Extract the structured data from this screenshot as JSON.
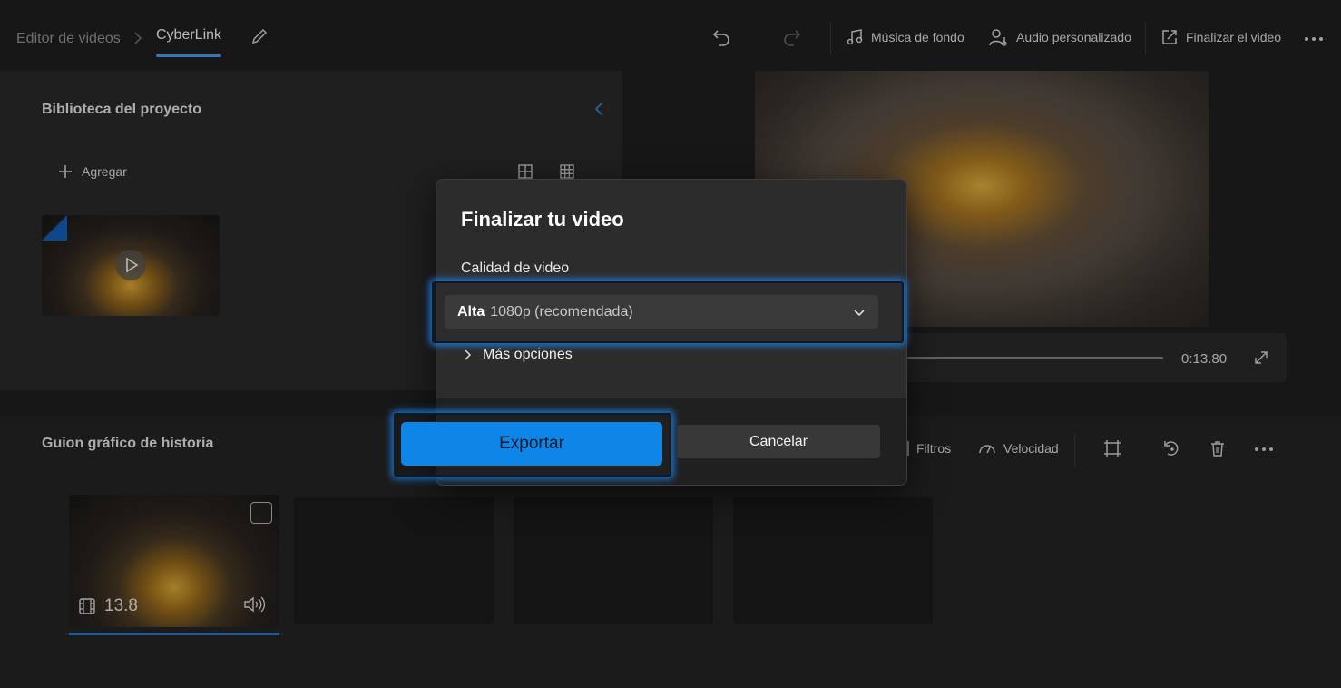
{
  "breadcrumb": {
    "root": "Editor de videos",
    "current": "CyberLink"
  },
  "toolbar": {
    "music_label": "Música de fondo",
    "audio_label": "Audio personalizado",
    "finish_label": "Finalizar el video"
  },
  "library": {
    "title": "Biblioteca del proyecto",
    "add_label": "Agregar"
  },
  "player": {
    "time": "0:13.80"
  },
  "storyboard": {
    "title": "Guion gráfico de historia",
    "filters_label": "Filtros",
    "speed_label": "Velocidad",
    "clip_duration": "13.8"
  },
  "dialog": {
    "title": "Finalizar tu video",
    "quality_label": "Calidad de video",
    "quality_value_bold": "Alta",
    "quality_value_rest": "1080p (recomendada)",
    "more_options": "Más opciones",
    "export_label": "Exportar",
    "cancel_label": "Cancelar"
  },
  "colors": {
    "accent": "#0e86e8",
    "highlight": "#1e8cff",
    "background": "#202020"
  }
}
